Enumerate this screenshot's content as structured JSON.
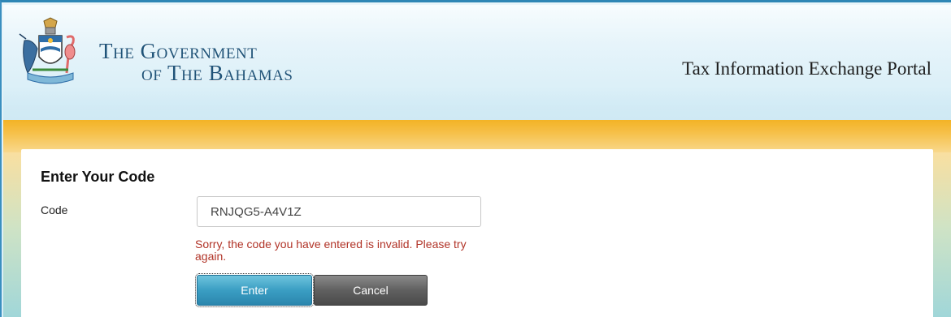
{
  "header": {
    "gov_line1": "The Government",
    "gov_line2": "of The Bahamas",
    "portal_title": "Tax Information Exchange Portal",
    "crest_icon": "bahamas-coat-of-arms-icon"
  },
  "form": {
    "title": "Enter Your Code",
    "code_label": "Code",
    "code_value": "RNJQG5-A4V1Z",
    "error_message": "Sorry, the code you have entered is invalid. Please try again.",
    "enter_label": "Enter",
    "cancel_label": "Cancel"
  },
  "colors": {
    "accent_blue": "#3a9ec3",
    "gold": "#f3b326",
    "error_red": "#b13327",
    "title_blue": "#1f5378"
  }
}
